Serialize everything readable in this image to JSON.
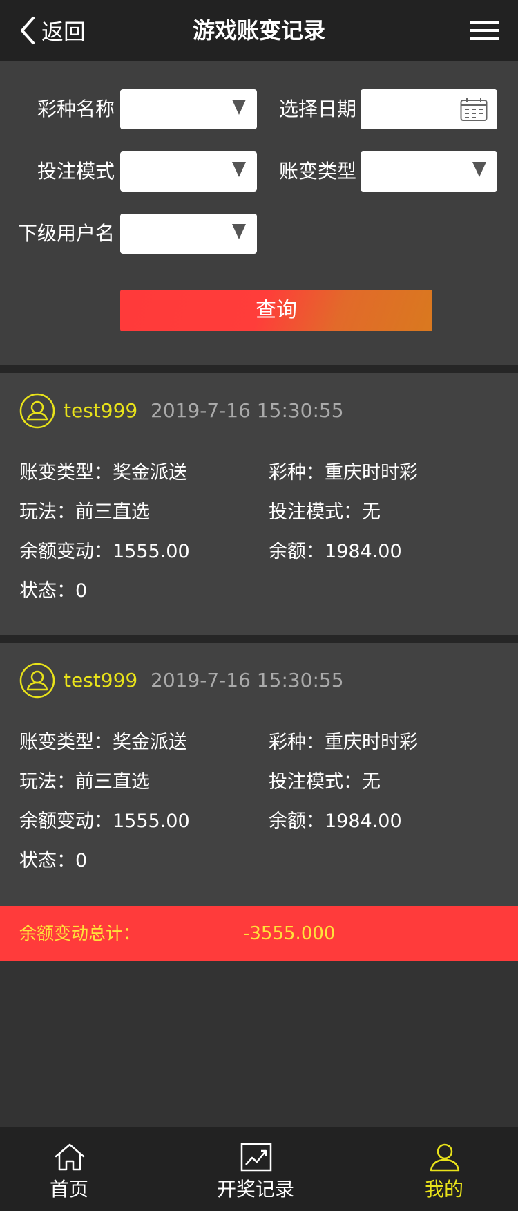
{
  "header": {
    "back_label": "返回",
    "title": "游戏账变记录"
  },
  "filters": {
    "lottery_label": "彩种名称",
    "date_label": "选择日期",
    "bet_mode_label": "投注模式",
    "change_type_label": "账变类型",
    "sub_user_label": "下级用户名",
    "lottery_value": "",
    "date_value": "",
    "bet_mode_value": "",
    "change_type_value": "",
    "sub_user_value": "",
    "query_label": "查询"
  },
  "records": [
    {
      "user": "test999",
      "time": "2019-7-16 15:30:55",
      "change_type": "账变类型：奖金派送",
      "lottery": "彩种：重庆时时彩",
      "play": "玩法：前三直选",
      "bet_mode": "投注模式：无",
      "balance_change": "余额变动：1555.00",
      "balance": "余额：1984.00",
      "status": "状态：0"
    },
    {
      "user": "test999",
      "time": "2019-7-16 15:30:55",
      "change_type": "账变类型：奖金派送",
      "lottery": "彩种：重庆时时彩",
      "play": "玩法：前三直选",
      "bet_mode": "投注模式：无",
      "balance_change": "余额变动：1555.00",
      "balance": "余额：1984.00",
      "status": "状态：0"
    }
  ],
  "total": {
    "label": "余额变动总计：",
    "value": "-3555.000"
  },
  "tabbar": {
    "items": [
      {
        "label": "首页",
        "icon": "home-icon",
        "active": false
      },
      {
        "label": "开奖记录",
        "icon": "chart-icon",
        "active": false
      },
      {
        "label": "我的",
        "icon": "user-icon",
        "active": true
      }
    ]
  },
  "colors": {
    "accent_yellow": "#e8e21a",
    "alert_red": "#ff3b3b",
    "header_bg": "#222222",
    "page_bg": "#333333"
  }
}
